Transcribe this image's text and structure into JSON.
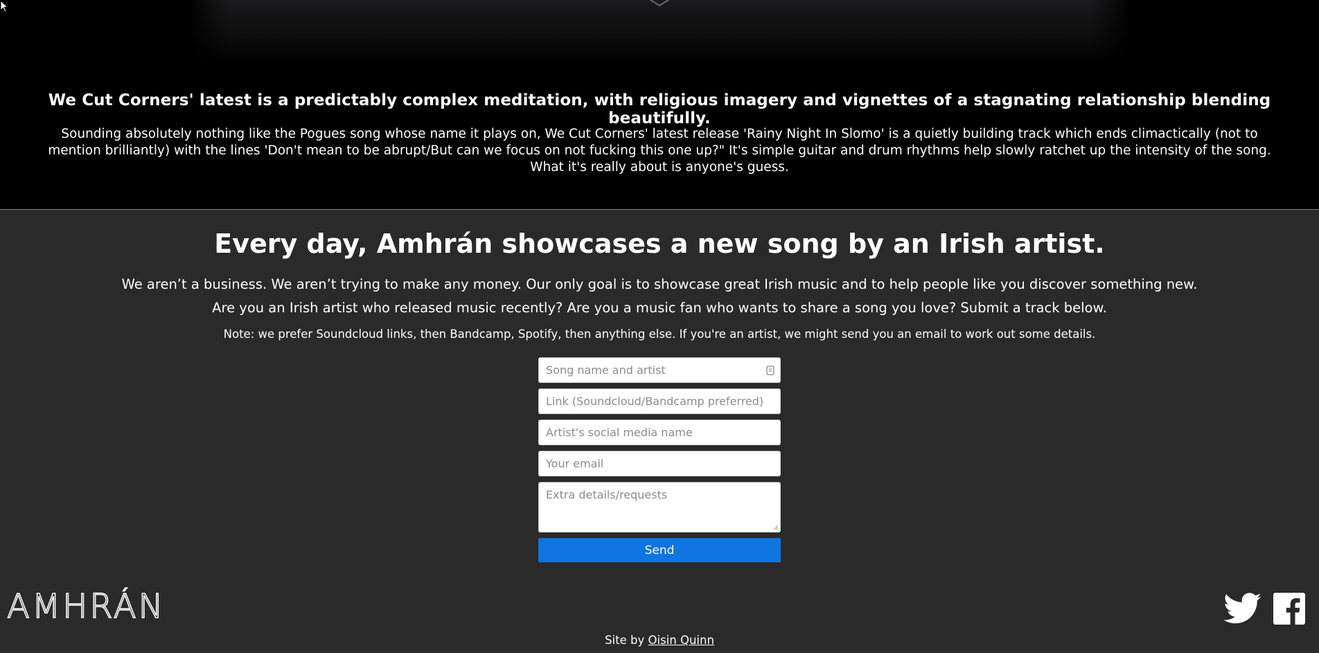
{
  "hero": {
    "headline": "We Cut Corners' latest is a predictably complex meditation, with religious imagery and vignettes of a stagnating relationship blending beautifully.",
    "body": "Sounding absolutely nothing like the Pogues song whose name it plays on, We Cut Corners' latest release 'Rainy Night In Slomo' is a quietly building track which ends climactically (not to mention brilliantly) with the lines 'Don't mean to be abrupt/But can we focus on not fucking this one up?\" It's simple guitar and drum rhythms help slowly ratchet up the intensity of the song. What it's really about is anyone's guess."
  },
  "main": {
    "title": "Every day, Amhrán showcases a new song by an Irish artist.",
    "paragraph1": "We aren’t a business. We aren’t trying to make any money. Our only goal is to showcase great Irish music and to help people like you discover something new.",
    "paragraph2": "Are you an Irish artist who released music recently? Are you a music fan who wants to share a song you love? Submit a track below.",
    "note": "Note: we prefer Soundcloud links, then Bandcamp, Spotify, then anything else. If you're an artist, we might send you an email to work out some details."
  },
  "form": {
    "song_placeholder": "Song name and artist",
    "link_placeholder": "Link (Soundcloud/Bandcamp preferred)",
    "social_placeholder": "Artist's social media name",
    "email_placeholder": "Your email",
    "details_placeholder": "Extra details/requests",
    "send_label": "Send"
  },
  "footer": {
    "logo_text": "AMHRÁN",
    "credit_prefix": "Site by ",
    "credit_link": "Oisin Quinn"
  },
  "icons": {
    "scroll": "chevron-down-icon",
    "autofill": "contact-card-icon",
    "social": [
      "twitter-icon",
      "facebook-icon"
    ]
  },
  "colors": {
    "hero_background": "#000000",
    "page_background": "#2a2a2a",
    "button": "#0f75e0",
    "text": "#ffffff"
  }
}
